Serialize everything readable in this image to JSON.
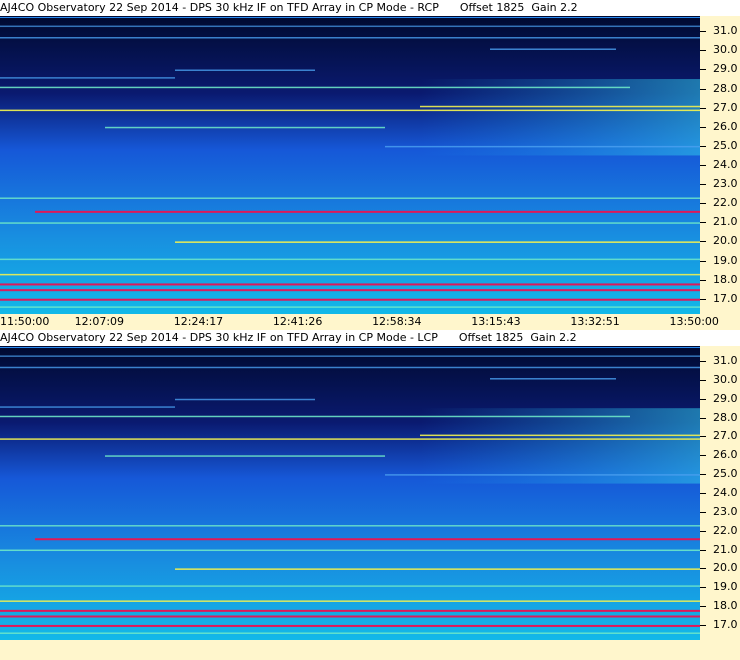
{
  "panels": [
    {
      "title": "AJ4CO Observatory 22 Sep 2014 - DPS 30 kHz IF on TFD Array in CP Mode - RCP      Offset 1825  Gain 2.2",
      "polarization": "RCP",
      "offset": 1825,
      "gain": 2.2
    },
    {
      "title": "AJ4CO Observatory 22 Sep 2014 - DPS 30 kHz IF on TFD Array in CP Mode - LCP      Offset 1825  Gain 2.2",
      "polarization": "LCP",
      "offset": 1825,
      "gain": 2.2
    }
  ],
  "freq_ticks": [
    "31.0",
    "30.0",
    "29.0",
    "28.0",
    "27.0",
    "26.0",
    "25.0",
    "24.0",
    "23.0",
    "22.0",
    "21.0",
    "20.0",
    "19.0",
    "18.0",
    "17.0"
  ],
  "freq_range_mhz": [
    16.2,
    31.8
  ],
  "time_ticks": [
    "11:50:00",
    "12:07:09",
    "12:24:17",
    "12:41:26",
    "12:58:34",
    "13:15:43",
    "13:32:51",
    "13:50:00"
  ],
  "colors": {
    "axis_bg": "#fff6cc",
    "background_dark": "#000a30",
    "background_blue": "#1658d8",
    "background_cyan": "#12b8e8",
    "band_yellow": "#f0f050",
    "band_red": "#e01858"
  },
  "spectral_bands": [
    {
      "freq": 31.3,
      "level": 0.35,
      "span": [
        0.0,
        1.0
      ]
    },
    {
      "freq": 30.7,
      "level": 0.55,
      "span": [
        0.0,
        1.0
      ]
    },
    {
      "freq": 30.1,
      "level": 0.6,
      "span": [
        0.7,
        0.88
      ]
    },
    {
      "freq": 29.0,
      "level": 0.55,
      "span": [
        0.25,
        0.45
      ]
    },
    {
      "freq": 28.6,
      "level": 0.5,
      "span": [
        0.0,
        0.25
      ]
    },
    {
      "freq": 28.1,
      "level": 0.75,
      "span": [
        0.0,
        0.9
      ]
    },
    {
      "freq": 27.1,
      "level": 0.8,
      "span": [
        0.6,
        1.0
      ]
    },
    {
      "freq": 26.9,
      "level": 0.85,
      "span": [
        0.0,
        1.0
      ]
    },
    {
      "freq": 26.0,
      "level": 0.7,
      "span": [
        0.15,
        0.55
      ]
    },
    {
      "freq": 25.0,
      "level": 0.6,
      "span": [
        0.55,
        1.0
      ]
    },
    {
      "freq": 22.3,
      "level": 0.65,
      "span": [
        0.0,
        1.0
      ]
    },
    {
      "freq": 21.6,
      "level": 1.0,
      "span": [
        0.05,
        1.0
      ]
    },
    {
      "freq": 21.0,
      "level": 0.75,
      "span": [
        0.0,
        1.0
      ]
    },
    {
      "freq": 20.0,
      "level": 0.9,
      "span": [
        0.25,
        1.0
      ]
    },
    {
      "freq": 19.1,
      "level": 0.65,
      "span": [
        0.0,
        1.0
      ]
    },
    {
      "freq": 18.3,
      "level": 0.8,
      "span": [
        0.0,
        1.0
      ]
    },
    {
      "freq": 17.8,
      "level": 1.0,
      "span": [
        0.0,
        1.0
      ]
    },
    {
      "freq": 17.5,
      "level": 0.95,
      "span": [
        0.0,
        1.0
      ]
    },
    {
      "freq": 17.0,
      "level": 1.0,
      "span": [
        0.0,
        1.0
      ]
    },
    {
      "freq": 16.6,
      "level": 0.7,
      "span": [
        0.0,
        1.0
      ]
    }
  ]
}
